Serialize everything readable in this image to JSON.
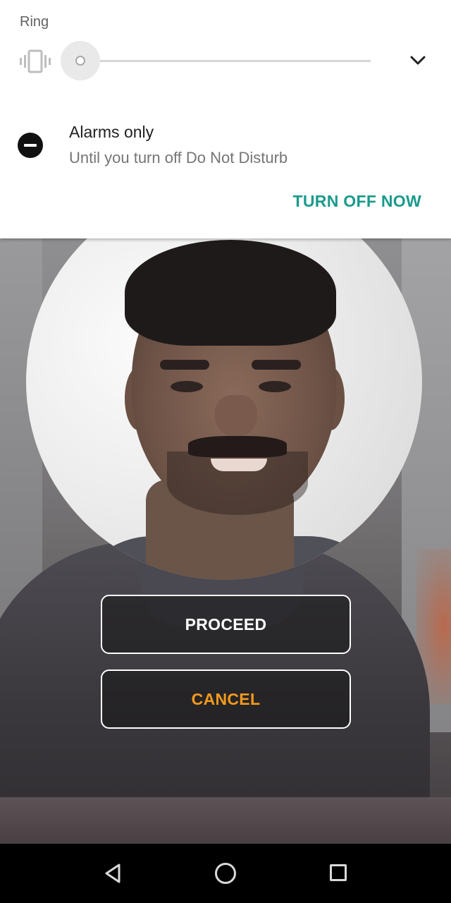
{
  "volume_panel": {
    "stream_label": "Ring",
    "level": 0,
    "mode_icon": "vibrate-icon",
    "expand_icon": "chevron-down-icon"
  },
  "dnd": {
    "icon": "do-not-disturb-icon",
    "title": "Alarms only",
    "subtitle": "Until you turn off Do Not Disturb",
    "action_label": "TURN OFF NOW"
  },
  "actions": {
    "proceed_label": "PROCEED",
    "cancel_label": "CANCEL"
  },
  "colors": {
    "accent_teal": "#1a9a8c",
    "cancel_orange": "#f39a1e"
  },
  "navbar": {
    "back_icon": "back-triangle-icon",
    "home_icon": "home-circle-icon",
    "recents_icon": "recents-square-icon"
  }
}
